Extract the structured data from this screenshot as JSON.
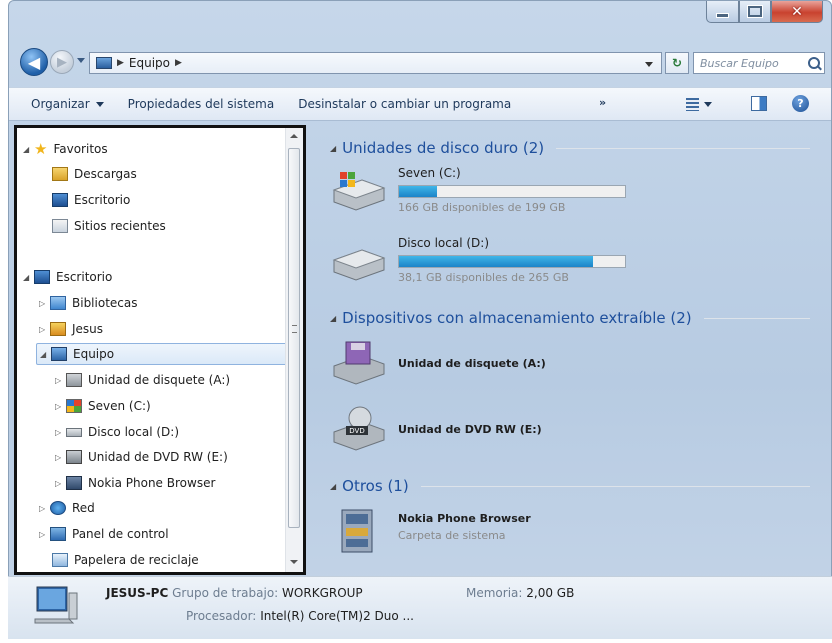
{
  "address": {
    "crumb": "Equipo"
  },
  "search": {
    "placeholder": "Buscar Equipo"
  },
  "toolbar": {
    "organize": "Organizar",
    "system_props": "Propiedades del sistema",
    "uninstall": "Desinstalar o cambiar un programa",
    "more": "»"
  },
  "tree": {
    "favorites": "Favoritos",
    "downloads": "Descargas",
    "desktop_fav": "Escritorio",
    "recent": "Sitios recientes",
    "desktop": "Escritorio",
    "libraries": "Bibliotecas",
    "user": "Jesus",
    "computer": "Equipo",
    "floppy": "Unidad de disquete (A:)",
    "seven": "Seven (C:)",
    "local_d": "Disco local (D:)",
    "dvd": "Unidad de DVD RW (E:)",
    "nokia": "Nokia Phone Browser",
    "network": "Red",
    "control_panel": "Panel de control",
    "recycle": "Papelera de reciclaje"
  },
  "groups": {
    "hdd": "Unidades de disco duro (2)",
    "removable": "Dispositivos con almacenamiento extraíble (2)",
    "other": "Otros (1)"
  },
  "drives": {
    "c": {
      "name": "Seven (C:)",
      "free": "166 GB disponibles de 199 GB",
      "used_fraction": 0.17
    },
    "d": {
      "name": "Disco local (D:)",
      "free": "38,1 GB disponibles de 265 GB",
      "used_fraction": 0.86
    },
    "a": {
      "name": "Unidad de disquete (A:)"
    },
    "e": {
      "name": "Unidad de DVD RW (E:)"
    }
  },
  "other_item": {
    "name": "Nokia Phone Browser",
    "type": "Carpeta de sistema"
  },
  "status": {
    "pc_name": "JESUS-PC",
    "workgroup_label": "Grupo de trabajo:",
    "workgroup_value": "WORKGROUP",
    "memory_label": "Memoria:",
    "memory_value": "2,00 GB",
    "cpu_label": "Procesador:",
    "cpu_value": "Intel(R) Core(TM)2 Duo ..."
  }
}
